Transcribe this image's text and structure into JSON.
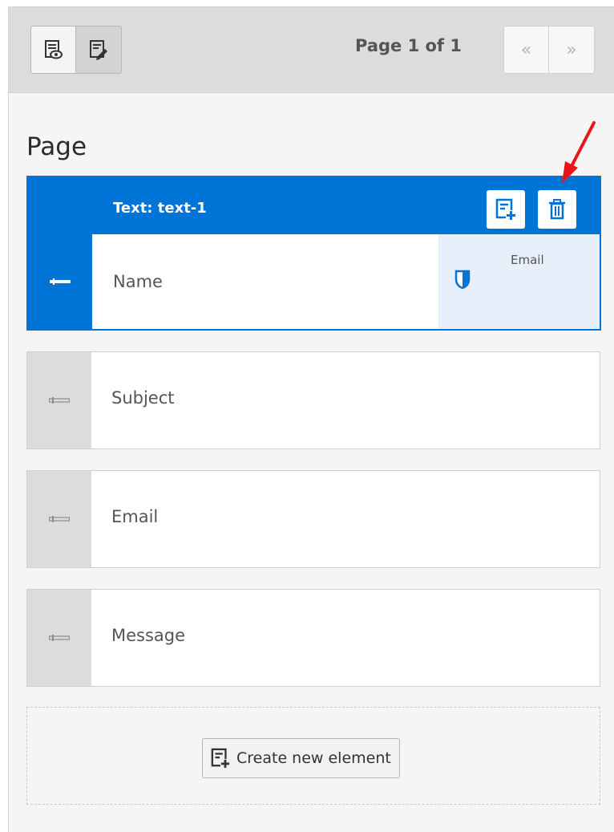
{
  "toolbar": {
    "preview_icon": "preview-icon",
    "edit_icon": "edit-icon",
    "page_info": "Page 1 of 1",
    "prev_label": "«",
    "next_label": "»"
  },
  "page": {
    "title": "Page"
  },
  "active_element": {
    "header_label": "Text: text-1",
    "field_label": "Name",
    "validator_label": "Email",
    "add_icon": "add-element-icon",
    "delete_icon": "trash-icon"
  },
  "elements": [
    {
      "label": "Subject"
    },
    {
      "label": "Email"
    },
    {
      "label": "Message"
    }
  ],
  "create_button": {
    "label": "Create new element"
  },
  "colors": {
    "accent": "#0073d6",
    "annotation_arrow": "#e8141a"
  }
}
